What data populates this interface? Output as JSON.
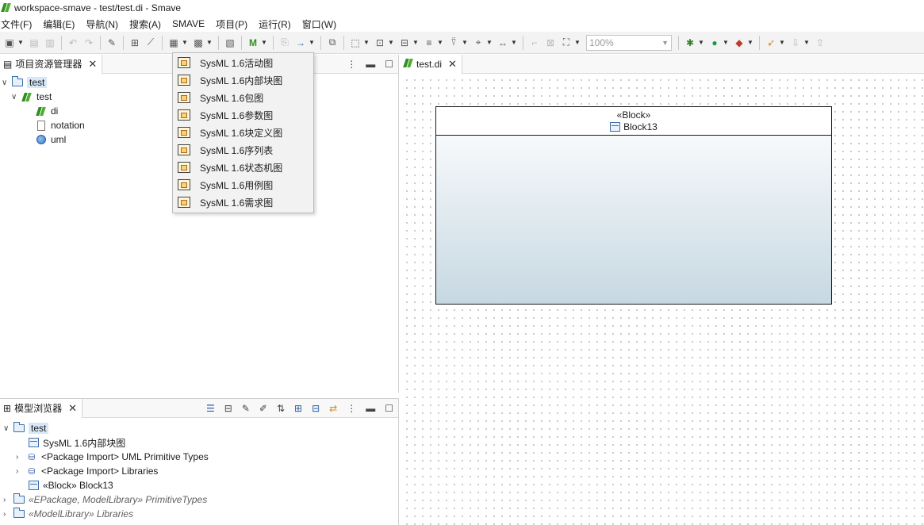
{
  "window": {
    "title": "workspace-smave - test/test.di - Smave"
  },
  "menubar": [
    "文件(F)",
    "编辑(E)",
    "导航(N)",
    "搜索(A)",
    "SMAVE",
    "项目(P)",
    "运行(R)",
    "窗口(W)"
  ],
  "toolbar": {
    "zoom_value": "100%"
  },
  "project_explorer": {
    "tab_label": "项目资源管理器",
    "tree": {
      "root": "test",
      "child": "test",
      "leaves": [
        "di",
        "notation",
        "uml"
      ]
    }
  },
  "popup_menu": {
    "items": [
      "SysML 1.6活动图",
      "SysML 1.6内部块图",
      "SysML 1.6包图",
      "SysML 1.6参数图",
      "SysML 1.6块定义图",
      "SysML 1.6序列表",
      "SysML 1.6状态机图",
      "SysML 1.6用例图",
      "SysML 1.6需求图"
    ]
  },
  "editor": {
    "tab_label": "test.di",
    "block": {
      "stereotype": "«Block»",
      "name": "Block13"
    }
  },
  "model_browser": {
    "tab_label": "模型浏览器",
    "root": "test",
    "items": [
      "SysML 1.6内部块图",
      "<Package Import> UML Primitive Types",
      "<Package Import> Libraries",
      "«Block» Block13"
    ],
    "extra": [
      "«EPackage, ModelLibrary» PrimitiveTypes",
      "«ModelLibrary» Libraries"
    ]
  }
}
